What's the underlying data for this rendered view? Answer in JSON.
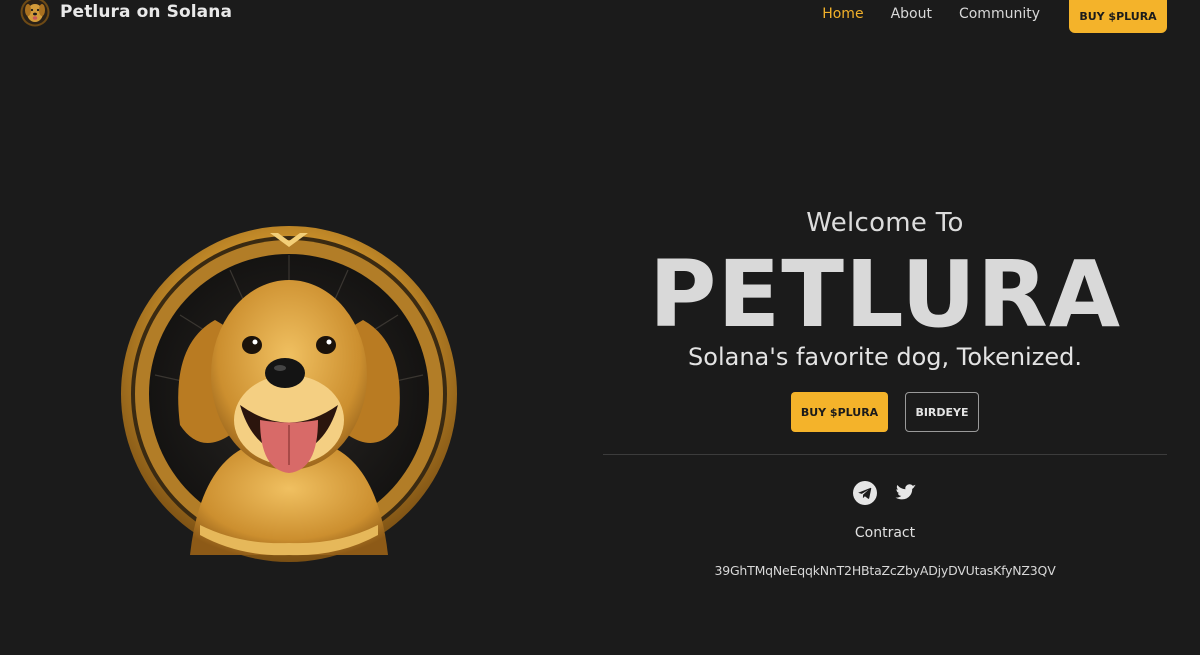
{
  "nav": {
    "brand_name": "Petlura on Solana",
    "links": [
      {
        "label": "Home",
        "active": true
      },
      {
        "label": "About",
        "active": false
      },
      {
        "label": "Community",
        "active": false
      }
    ],
    "buy_label": "BUY $PLURA"
  },
  "hero": {
    "welcome": "Welcome To",
    "title": "PETLURA",
    "tagline": "Solana's favorite dog, Tokenized.",
    "buy_label": "BUY $PLURA",
    "birdeye_label": "BIRDEYE",
    "socials": [
      {
        "icon": "telegram-icon"
      },
      {
        "icon": "twitter-icon"
      }
    ],
    "contract_label": "Contract",
    "contract_address": "39GhTMqNeEqqkNnT2HBtaZcZbyADjyDVUtasKfyNZ3QV"
  },
  "colors": {
    "background": "#1b1b1b",
    "accent": "#f4b32a",
    "text": "#e3e3e3"
  }
}
